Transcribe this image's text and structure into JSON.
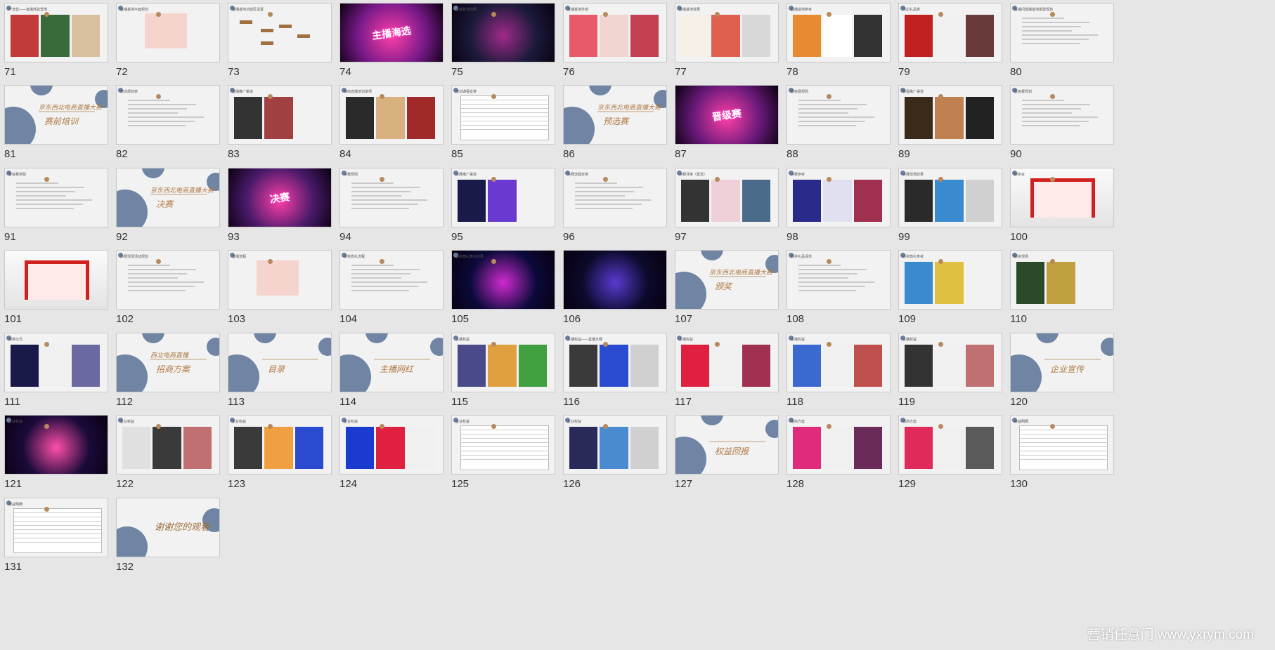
{
  "slides": [
    {
      "n": "71",
      "type": "photo",
      "colors": [
        "#c23a3a",
        "#3a6a3a",
        "#d9c0a0"
      ],
      "header": "产流营——直播体验营地"
    },
    {
      "n": "72",
      "type": "diagram",
      "header": "直播基地平面规划"
    },
    {
      "n": "73",
      "type": "flow",
      "header": "直播基地功能区设置"
    },
    {
      "n": "74",
      "type": "stage",
      "text": "主播海选",
      "colors": [
        "#7a1a8a",
        "#ff3fa8"
      ]
    },
    {
      "n": "75",
      "type": "stage",
      "text": "",
      "colors": [
        "#1a1a3a",
        "#a02a8a"
      ],
      "header": "直播基地效果"
    },
    {
      "n": "76",
      "type": "photo",
      "colors": [
        "#e85a6a",
        "#f1d5d0",
        "#c24050"
      ],
      "header": "直播基地外部"
    },
    {
      "n": "77",
      "type": "photo",
      "colors": [
        "#f5efe8",
        "#e06050",
        "#d8d8d8"
      ],
      "header": "直播基地效果"
    },
    {
      "n": "78",
      "type": "photo",
      "colors": [
        "#e88a30",
        "#ffffff",
        "#333333"
      ],
      "header": "直播基地参考"
    },
    {
      "n": "79",
      "type": "photo",
      "colors": [
        "#c02020",
        "#f0f0f0",
        "#6a3a3a"
      ],
      "header": "周边礼品类"
    },
    {
      "n": "80",
      "type": "text",
      "header": "直播间直播基地搭建规划"
    },
    {
      "n": "81",
      "type": "title",
      "title": "赛前培训",
      "subtitle": "京东西北电商直播大赛"
    },
    {
      "n": "82",
      "type": "text",
      "header": "培训规划表"
    },
    {
      "n": "83",
      "type": "photo",
      "colors": [
        "#333333",
        "#a04040",
        "#f2f2f2"
      ],
      "header": "直播推广渠道"
    },
    {
      "n": "84",
      "type": "photo",
      "colors": [
        "#2a2a2a",
        "#d9b080",
        "#a02a2a"
      ],
      "header": "电商直播培训讲师"
    },
    {
      "n": "85",
      "type": "table",
      "header": "培训课程安排"
    },
    {
      "n": "86",
      "type": "title",
      "title": "预选赛",
      "subtitle": "京东西北电商直播大赛"
    },
    {
      "n": "87",
      "type": "stage",
      "text": "晋级赛",
      "colors": [
        "#6a1a7a",
        "#ff3fa8"
      ]
    },
    {
      "n": "88",
      "type": "text",
      "header": "晋级赛规则"
    },
    {
      "n": "89",
      "type": "photo",
      "colors": [
        "#3a2a1a",
        "#c08050",
        "#222222"
      ],
      "header": "赛程推广渠道"
    },
    {
      "n": "90",
      "type": "text",
      "header": "晋级赛规划"
    },
    {
      "n": "91",
      "type": "text",
      "header": "晋级赛奖励"
    },
    {
      "n": "92",
      "type": "title",
      "title": "决赛",
      "subtitle": "京东西北电商直播大赛"
    },
    {
      "n": "93",
      "type": "stage",
      "text": "决赛",
      "colors": [
        "#4a1a6a",
        "#ff3fa8"
      ]
    },
    {
      "n": "94",
      "type": "text",
      "header": "决赛规则"
    },
    {
      "n": "95",
      "type": "photo",
      "colors": [
        "#1a1a4a",
        "#6a3ad0",
        "#f2f2f2"
      ],
      "header": "决赛推广渠道"
    },
    {
      "n": "96",
      "type": "text",
      "header": "决赛流程安排"
    },
    {
      "n": "97",
      "type": "photo",
      "colors": [
        "#333333",
        "#f0d0d8",
        "#4a6a8a"
      ],
      "header": "决赛评审（嘉宾）"
    },
    {
      "n": "98",
      "type": "photo",
      "colors": [
        "#2a2a8a",
        "#e0e0f0",
        "#a03050"
      ],
      "header": "决赛参考"
    },
    {
      "n": "99",
      "type": "photo",
      "colors": [
        "#2a2a2a",
        "#3a8ad0",
        "#d0d0d0"
      ],
      "header": "决赛现场效果"
    },
    {
      "n": "100",
      "type": "booth",
      "header": "颁奖台",
      "colors": [
        "#d02020",
        "#f6f6f6"
      ]
    },
    {
      "n": "101",
      "type": "booth",
      "header": "",
      "colors": [
        "#d02020",
        "#f0f0f0"
      ]
    },
    {
      "n": "102",
      "type": "text",
      "header": "决赛现场活动规划"
    },
    {
      "n": "103",
      "type": "diagram",
      "header": "直播流程"
    },
    {
      "n": "104",
      "type": "text",
      "header": "颁奖典礼流程"
    },
    {
      "n": "105",
      "type": "stage",
      "text": "",
      "colors": [
        "#0a0a3a",
        "#d02ad0"
      ],
      "header": "颁奖典礼舞台效果"
    },
    {
      "n": "106",
      "type": "stage",
      "text": "",
      "colors": [
        "#0a0a2a",
        "#5a3ad0"
      ],
      "header": ""
    },
    {
      "n": "107",
      "type": "title",
      "title": "颁奖",
      "subtitle": "京东西北电商直播大赛"
    },
    {
      "n": "108",
      "type": "text",
      "header": "颁奖礼品清单"
    },
    {
      "n": "109",
      "type": "photo",
      "colors": [
        "#3a8ad0",
        "#e0c040",
        "#f2f2f2"
      ],
      "header": "颁奖典礼参考"
    },
    {
      "n": "110",
      "type": "photo",
      "colors": [
        "#2a4a2a",
        "#c0a040",
        "#f2f2f2"
      ],
      "header": "颁奖现场"
    },
    {
      "n": "111",
      "type": "photo",
      "colors": [
        "#1a1a4a",
        "#f0f0f0",
        "#6a6aa0"
      ],
      "header": "颁奖仪式"
    },
    {
      "n": "112",
      "type": "title",
      "title": "招商方案",
      "subtitle": "西北电商直播"
    },
    {
      "n": "113",
      "type": "title",
      "title": "目录",
      "subtitle": ""
    },
    {
      "n": "114",
      "type": "title",
      "title": "主播网红",
      "subtitle": ""
    },
    {
      "n": "115",
      "type": "photo",
      "colors": [
        "#4a4a8a",
        "#e0a040",
        "#40a040"
      ],
      "header": "主播权益"
    },
    {
      "n": "116",
      "type": "photo",
      "colors": [
        "#3a3a3a",
        "#2a4ad0",
        "#d0d0d0"
      ],
      "header": "主播权益——直播大赛"
    },
    {
      "n": "117",
      "type": "photo",
      "colors": [
        "#e02040",
        "#f0f0f0",
        "#a03050"
      ],
      "header": "主播权益"
    },
    {
      "n": "118",
      "type": "photo",
      "colors": [
        "#3a6ad0",
        "#f0f0f0",
        "#c05050"
      ],
      "header": "主播权益"
    },
    {
      "n": "119",
      "type": "photo",
      "colors": [
        "#333333",
        "#f0f0f0",
        "#c07070"
      ],
      "header": "主播权益"
    },
    {
      "n": "120",
      "type": "title",
      "title": "企业宣传",
      "subtitle": ""
    },
    {
      "n": "121",
      "type": "stage",
      "text": "",
      "colors": [
        "#1a0a3a",
        "#ff4fa8"
      ],
      "header": "企业权益"
    },
    {
      "n": "122",
      "type": "photo",
      "colors": [
        "#e0e0e0",
        "#3a3a3a",
        "#c07070"
      ],
      "header": "企业权益"
    },
    {
      "n": "123",
      "type": "photo",
      "colors": [
        "#3a3a3a",
        "#f0a040",
        "#2a4ad0"
      ],
      "header": "企业权益"
    },
    {
      "n": "124",
      "type": "photo",
      "colors": [
        "#1a3ad0",
        "#e02040",
        "#f0f0f0"
      ],
      "header": "企业权益"
    },
    {
      "n": "125",
      "type": "table",
      "header": "企业权益"
    },
    {
      "n": "126",
      "type": "photo",
      "colors": [
        "#2a2a5a",
        "#4a8ad0",
        "#d0d0d0"
      ],
      "header": "企业权益"
    },
    {
      "n": "127",
      "type": "title",
      "title": "权益回报",
      "subtitle": ""
    },
    {
      "n": "128",
      "type": "photo",
      "colors": [
        "#e02a7a",
        "#f0f0f0",
        "#6a2a5a"
      ],
      "header": "招商方案"
    },
    {
      "n": "129",
      "type": "photo",
      "colors": [
        "#e02a5a",
        "#f0f0f0",
        "#5a5a5a"
      ],
      "header": "招商方案"
    },
    {
      "n": "130",
      "type": "table",
      "header": "权益明细"
    },
    {
      "n": "131",
      "type": "table",
      "header": "权益明细"
    },
    {
      "n": "132",
      "type": "thanks",
      "title": "谢谢您的观看",
      "subtitle": ""
    }
  ],
  "watermark": "营销任意门 www.yxrym.com"
}
